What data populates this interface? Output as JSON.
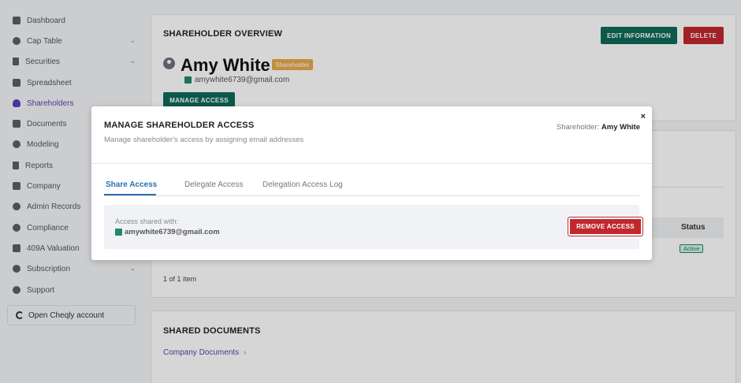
{
  "sidebar": {
    "items": [
      {
        "label": "Dashboard"
      },
      {
        "label": "Cap Table"
      },
      {
        "label": "Securities"
      },
      {
        "label": "Spreadsheet"
      },
      {
        "label": "Shareholders"
      },
      {
        "label": "Documents"
      },
      {
        "label": "Modeling"
      },
      {
        "label": "Reports"
      },
      {
        "label": "Company"
      },
      {
        "label": "Admin Records"
      },
      {
        "label": "Compliance"
      },
      {
        "label": "409A Valuation"
      },
      {
        "label": "Subscription"
      },
      {
        "label": "Support"
      }
    ],
    "cheqly_label": "Open Cheqly account"
  },
  "overview": {
    "title": "SHAREHOLDER OVERVIEW",
    "edit_label": "EDIT INFORMATION",
    "delete_label": "DELETE",
    "name": "Amy White",
    "badge": "Shareholder",
    "email": "amywhite6739@gmail.com",
    "manage_access_label": "MANAGE ACCESS"
  },
  "access_table": {
    "status_header": "Status",
    "status_value": "Active",
    "pagination": "1 of 1 item"
  },
  "shared_docs": {
    "title": "SHARED DOCUMENTS",
    "link": "Company Documents"
  },
  "modal": {
    "title": "MANAGE SHAREHOLDER ACCESS",
    "subtitle": "Manage shareholder's access by assigning email addresses",
    "holder_label": "Shareholder:",
    "holder_name": "Amy White",
    "close": "×",
    "tabs": [
      {
        "label": "Share Access"
      },
      {
        "label": "Delegate Access"
      },
      {
        "label": "Delegation Access Log"
      }
    ],
    "shared_with_label": "Access shared with:",
    "shared_email": "amywhite6739@gmail.com",
    "remove_label": "REMOVE ACCESS"
  },
  "colors": {
    "accent_purple": "#5b3fb5",
    "green": "#0f6b5a",
    "red": "#c0282e",
    "badge": "#e9a84a",
    "tab_active": "#2a6fb5"
  }
}
